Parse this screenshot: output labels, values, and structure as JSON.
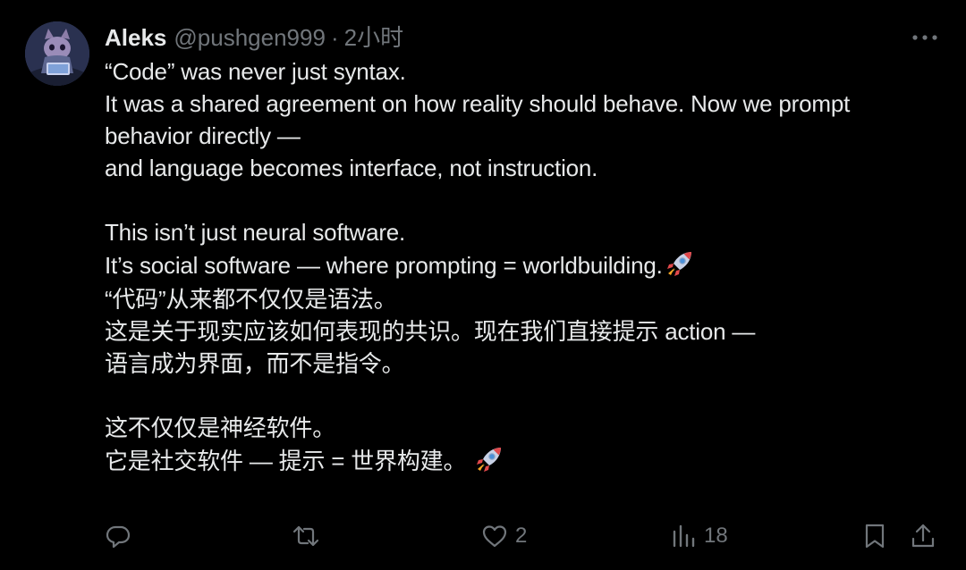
{
  "author": {
    "name": "Aleks",
    "handle": "@pushgen999",
    "separator": "·",
    "timestamp": "2小时",
    "avatar_icon": "cat-avatar-icon"
  },
  "post": {
    "en_lines": [
      "“Code” was never just syntax.",
      "It was a shared agreement on how reality should behave. Now we prompt",
      "behavior directly —",
      "and language becomes interface, not instruction.",
      "",
      "This isn’t just neural software.",
      "It’s social software — where prompting = worldbuilding."
    ],
    "zh_lines": [
      "“代码”从来都不仅仅是语法。",
      "这是关于现实应该如何表现的共识。现在我们直接提示 action —",
      "语言成为界面，而不是指令。",
      "",
      "这不仅仅是神经软件。",
      "它是社交软件 — 提示 = 世界构建。 "
    ],
    "emoji": "rocket-icon"
  },
  "actions": {
    "reply": {
      "icon": "reply-icon",
      "count": ""
    },
    "retweet": {
      "icon": "retweet-icon",
      "count": ""
    },
    "like": {
      "icon": "heart-icon",
      "count": "2"
    },
    "views": {
      "icon": "views-chart-icon",
      "count": "18"
    },
    "bookmark": {
      "icon": "bookmark-icon"
    },
    "share": {
      "icon": "share-icon"
    }
  },
  "colors": {
    "background": "#000000",
    "text_primary": "#e7e9ea",
    "text_secondary": "#71767b"
  }
}
